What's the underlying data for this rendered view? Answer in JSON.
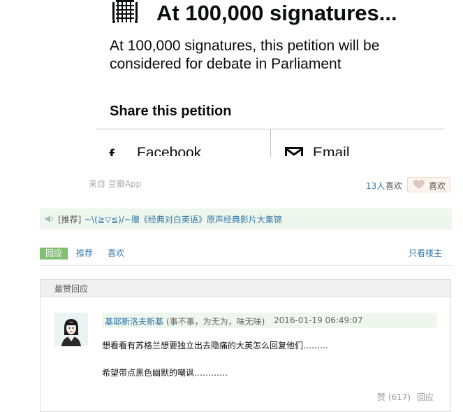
{
  "petition": {
    "heading": "At 100,000 signatures...",
    "body": "At 100,000 signatures, this petition will be considered for debate in Parliament",
    "share_title": "Share this petition",
    "share_buttons": [
      {
        "label": "Facebook",
        "icon": "facebook-icon"
      },
      {
        "label": "Email",
        "icon": "email-icon"
      }
    ]
  },
  "post": {
    "source": "来自 豆瓣App",
    "likes_count": "13人",
    "likes_suffix": "喜欢",
    "like_button": "喜欢"
  },
  "recommend": {
    "tag": "[推荐]",
    "link": "~\\(≧▽≦)/~赠《经典对白英语》原声经典影片大集锦"
  },
  "tabs": {
    "reply": "回应",
    "recommend": "推荐",
    "like": "喜欢",
    "owner_only": "只看楼主"
  },
  "best_replies": {
    "heading": "最赞回应",
    "comment": {
      "author": "基耶斯洛夫斯基",
      "signature": "(事不事，为无为，味无味)",
      "time": "2016-01-19 06:49:07",
      "lines": [
        "想看看有苏格兰想要独立出去隐痛的大英怎么回复他们………",
        "希望带点黑色幽默的嘲讽…………"
      ],
      "vote": "赞 (617)",
      "reply": "回应"
    }
  },
  "colors": {
    "link": "#3377aa",
    "accent_green": "#83bf73",
    "highlight_bg": "#eef6ee"
  }
}
